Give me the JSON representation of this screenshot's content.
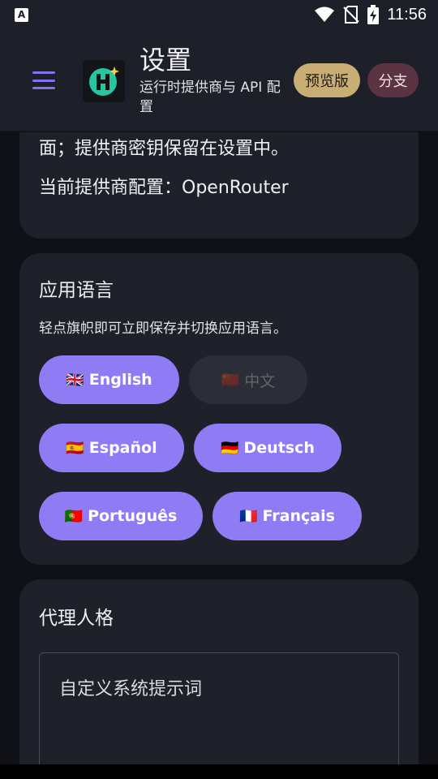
{
  "status": {
    "time": "11:56",
    "notification_icon": "a-icon",
    "icons": [
      "wifi-icon",
      "no-sim-icon",
      "battery-charging-icon"
    ]
  },
  "header": {
    "title": "设置",
    "subtitle": "运行时提供商与 API 配置",
    "preview_label": "预览版",
    "branch_label": "分支",
    "colors": {
      "accent": "#7f73f0",
      "preview_bg": "#c9ad73",
      "branch_bg": "#5b3343"
    }
  },
  "provider_card": {
    "line1": "面；提供商密钥保留在设置中。",
    "line2": "当前提供商配置：OpenRouter"
  },
  "language_card": {
    "title": "应用语言",
    "description": "轻点旗帜即可立即保存并切换应用语言。",
    "options": [
      {
        "flag": "🇬🇧",
        "label": "English",
        "selected": false
      },
      {
        "flag": "🇨🇳",
        "label": "中文",
        "selected": true
      },
      {
        "flag": "🇪🇸",
        "label": "Español",
        "selected": false
      },
      {
        "flag": "🇩🇪",
        "label": "Deutsch",
        "selected": false
      },
      {
        "flag": "🇵🇹",
        "label": "Português",
        "selected": false
      },
      {
        "flag": "🇫🇷",
        "label": "Français",
        "selected": false
      }
    ],
    "chip_color": "#8f7cf4"
  },
  "persona_card": {
    "title": "代理人格",
    "prompt_placeholder": "自定义系统提示词"
  }
}
